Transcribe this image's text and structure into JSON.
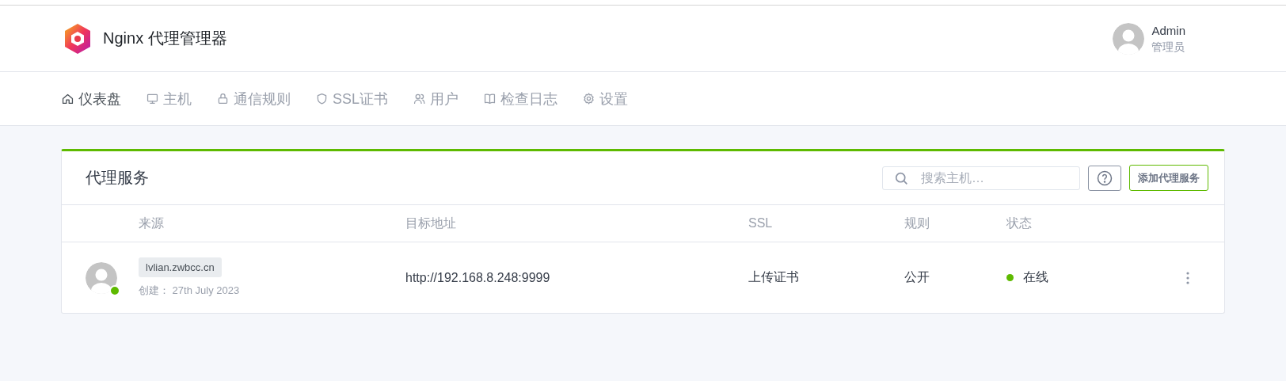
{
  "header": {
    "title": "Nginx 代理管理器",
    "user": {
      "name": "Admin",
      "role": "管理员"
    }
  },
  "nav": [
    {
      "label": "仪表盘",
      "kind": "dashboard",
      "selected": true
    },
    {
      "label": "主机",
      "kind": "hosts",
      "selected": false
    },
    {
      "label": "通信规则",
      "kind": "access",
      "selected": false
    },
    {
      "label": "SSL证书",
      "kind": "ssl",
      "selected": false
    },
    {
      "label": "用户",
      "kind": "users",
      "selected": false
    },
    {
      "label": "检查日志",
      "kind": "audit",
      "selected": false
    },
    {
      "label": "设置",
      "kind": "settings",
      "selected": false
    }
  ],
  "card": {
    "title": "代理服务",
    "search": {
      "placeholder": "搜索主机…"
    },
    "add_button": "添加代理服务",
    "table": {
      "columns": [
        "来源",
        "目标地址",
        "SSL",
        "规则",
        "状态"
      ],
      "rows": [
        {
          "source": "lvlian.zwbcc.cn",
          "created": "创建： 27th July 2023",
          "online": true,
          "destination": "http://192.168.8.248:9999",
          "ssl": "上传证书",
          "rule": "公开",
          "status": "在线"
        }
      ]
    }
  }
}
